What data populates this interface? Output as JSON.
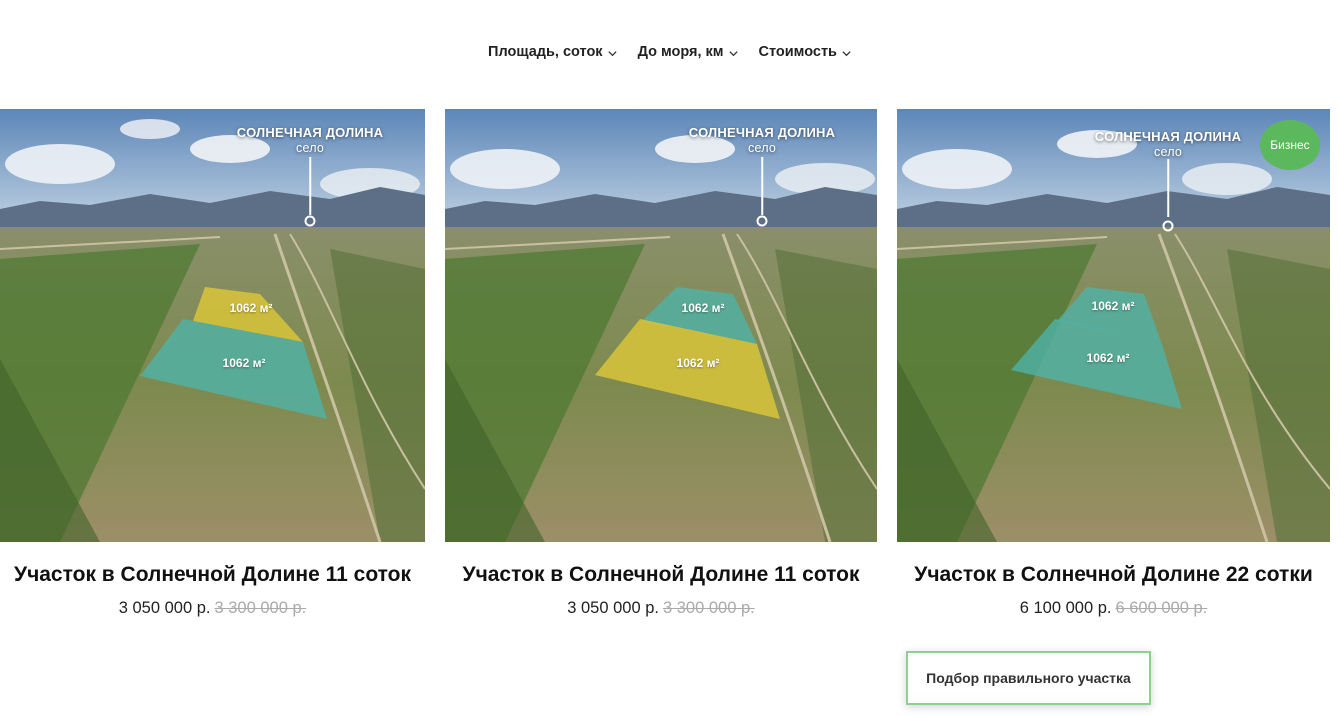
{
  "filters": [
    {
      "label": "Площадь, соток"
    },
    {
      "label": "До моря, км"
    },
    {
      "label": "Стоимость"
    }
  ],
  "cards": [
    {
      "village_name": "СОЛНЕЧНАЯ ДОЛИНА",
      "village_sub": "село",
      "plot_top_label": "1062 м²",
      "plot_bottom_label": "1062 м²",
      "title": "Участок в Солнечной Долине 11 соток",
      "price": "3 050 000 р.",
      "old_price": "3 300 000 р."
    },
    {
      "village_name": "СОЛНЕЧНАЯ ДОЛИНА",
      "village_sub": "село",
      "plot_top_label": "1062 м²",
      "plot_bottom_label": "1062 м²",
      "title": "Участок в Солнечной Долине 11 соток",
      "price": "3 050 000 р.",
      "old_price": "3 300 000 р."
    },
    {
      "village_name": "СОЛНЕЧНАЯ ДОЛИНА",
      "village_sub": "село",
      "plot_top_label": "1062 м²",
      "plot_bottom_label": "1062 м²",
      "badge": "Бизнес",
      "title": "Участок в Солнечной Долине 22 сотки",
      "price": "6 100 000 р.",
      "old_price": "6 600 000 р."
    }
  ],
  "cta": {
    "label": "Подбор правильного участка"
  },
  "colors": {
    "plot_yellow": "#d9c43a",
    "plot_teal": "#4fb3a8",
    "badge_green": "#5cb85c",
    "cta_border": "#8fd08f"
  }
}
